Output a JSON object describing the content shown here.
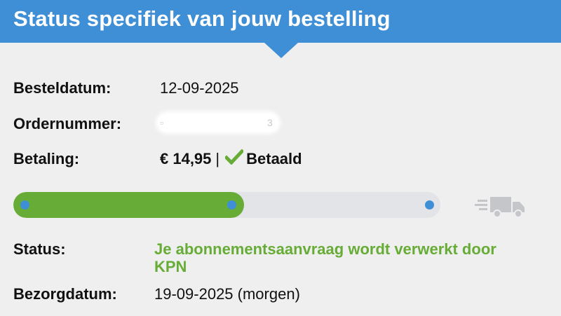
{
  "header": {
    "title": "Status specifiek van jouw bestelling"
  },
  "order": {
    "order_date_label": "Besteldatum:",
    "order_date": "12-09-2025",
    "order_number_label": "Ordernummer:",
    "payment_label": "Betaling:",
    "payment_amount": "€ 14,95",
    "payment_separator": "|",
    "payment_status": "Betaald",
    "status_label": "Status:",
    "status": "Je abonnementsaanvraag wordt verwerkt door KPN",
    "delivery_label": "Bezorgdatum:",
    "delivery_date": "19-09-2025 (morgen)"
  },
  "progress": {
    "steps_total": 3,
    "steps_completed": 2,
    "fill_fraction": 0.54
  },
  "colors": {
    "header": "#3f8fd6",
    "progress_fill": "#66ac36",
    "progress_track": "#e2e4e8",
    "status_text": "#66ac36",
    "check": "#66ac36",
    "truck": "#c4c6ca"
  },
  "icons": {
    "payment_status": "check-icon",
    "delivery": "truck-icon"
  }
}
